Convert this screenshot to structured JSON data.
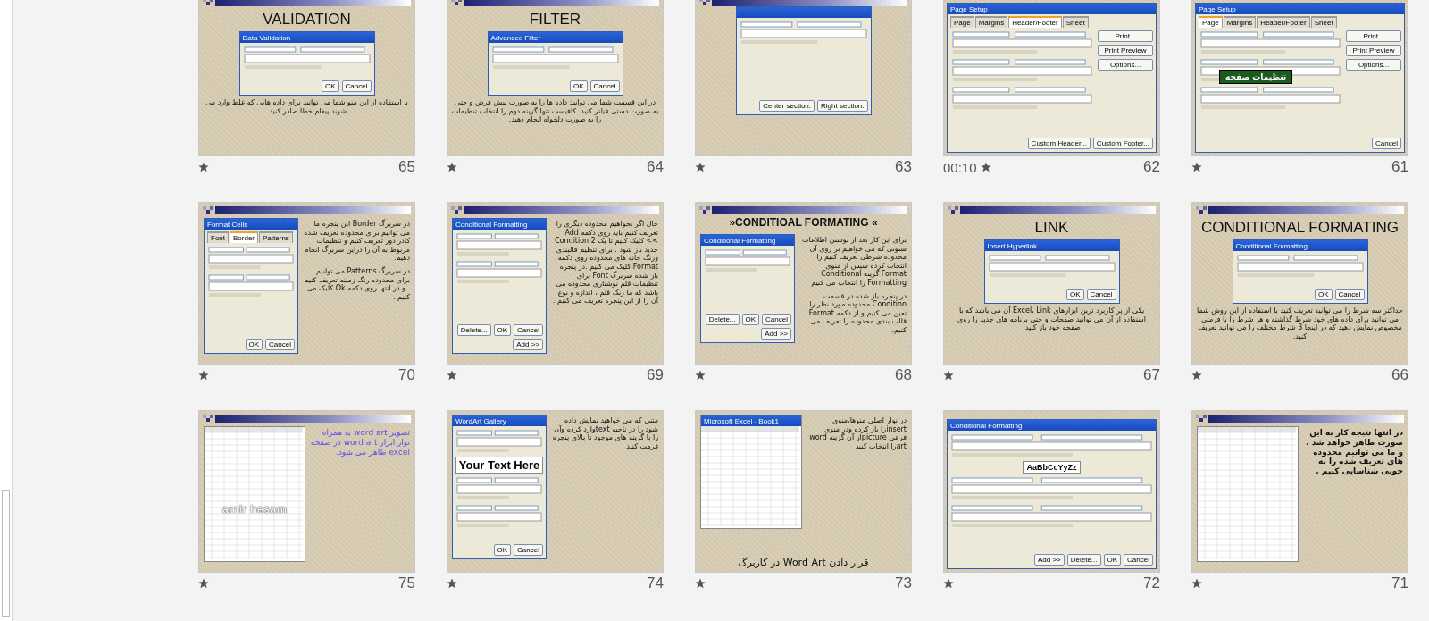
{
  "slides": [
    {
      "number": "61",
      "transition": true,
      "header_bar": false,
      "kind": "full",
      "callout": "تنظیمات صفحه",
      "shot": {
        "kind": "dialog",
        "title": "Page Setup",
        "tabs": [
          {
            "label": "Sheet",
            "selected": false
          },
          {
            "label": "Header/Footer",
            "selected": false
          },
          {
            "label": "Margins",
            "selected": false
          },
          {
            "label": "Page",
            "selected": true
          }
        ],
        "side_buttons": [
          "Print...",
          "Print Preview",
          "Options..."
        ],
        "buttons": [
          "Cancel"
        ]
      }
    },
    {
      "number": "62",
      "timing": "00:10",
      "transition": true,
      "header_bar": false,
      "kind": "full",
      "shot": {
        "kind": "dialog",
        "title": "Page Setup",
        "tabs": [
          {
            "label": "Sheet",
            "selected": false
          },
          {
            "label": "Header/Footer",
            "selected": true
          },
          {
            "label": "Margins",
            "selected": false
          },
          {
            "label": "Page",
            "selected": false
          }
        ],
        "side_buttons": [
          "Print...",
          "Print Preview",
          "Options..."
        ],
        "buttons": [
          "Custom Footer...",
          "Custom Header..."
        ]
      }
    },
    {
      "number": "63",
      "transition": true,
      "header_bar": true,
      "kind": "title-top",
      "shot": {
        "kind": "dialog",
        "buttons": [
          "Right section:",
          "Center section:"
        ]
      }
    },
    {
      "number": "64",
      "transition": true,
      "header_bar": true,
      "kind": "title-top",
      "title": "FILTER",
      "shot": {
        "kind": "dialog",
        "title": "Advanced Filter",
        "buttons": [
          "Cancel",
          "OK"
        ]
      },
      "body": [
        "در این قسمت شما می توانید داده ها را به صورت پیش فرض و حتی به صورت دستی فیلتر کنید. کافیست تنها گزینه دوم را انتخاب تنظیمات را به صورت دلخواه انجام دهید."
      ]
    },
    {
      "number": "65",
      "transition": true,
      "header_bar": true,
      "kind": "title-top",
      "title": "VALIDATION",
      "shot": {
        "kind": "dialog",
        "title": "Data Validation",
        "buttons": [
          "Cancel",
          "OK"
        ]
      },
      "body": [
        "با استفاده از این منو شما می توانید برای داده هایی که غلط وارد می شوند پیغام خطا صادر کنید."
      ]
    },
    {
      "number": "66",
      "transition": true,
      "header_bar": true,
      "kind": "title-top",
      "title": "CONDITIONAL FORMATING",
      "shot": {
        "kind": "dialog",
        "title": "Conditional Formatting",
        "buttons": [
          "Cancel",
          "OK"
        ]
      },
      "body": [
        "حداکثر سه شرط را می توانید تعریف کنید با استفاده از این روش شما می توانید برای داده های خود شرط گذاشته و هر شرط را با فرمتی مخصوص نمایش دهید که در اینجا 3 شرط مختلف را می توانید تعریف کنید."
      ]
    },
    {
      "number": "67",
      "transition": true,
      "header_bar": true,
      "kind": "title-top",
      "title": "LINK",
      "shot": {
        "kind": "dialog",
        "title": "Insert Hyperlink",
        "buttons": [
          "Cancel",
          "OK"
        ]
      },
      "body": [
        "یکی از پر کاربرد ترین ابزارهای Excel، Link آن می باشد که با استفاده از آن می توانید صفحات و حتی برنامه های جدید را روی صفحه خود باز کنید."
      ]
    },
    {
      "number": "68",
      "transition": true,
      "header_bar": true,
      "kind": "side",
      "title": "»CONDITIOAL FORMATING «",
      "shot": {
        "kind": "dialog",
        "title": "Conditional Formatting",
        "buttons": [
          "Cancel",
          "OK",
          "Delete...",
          "Add >>"
        ]
      },
      "body": [
        "برای این کار بعد از نوشتن اطلاعات ستونی که می خواهیم بر روی آن محدوده شرطی تعریف کنیم را انتخاب کرده سپس از منوی Format گزینه Conditional Formatting را انتخاب می کنیم",
        "در پنجره باز شده در قسمت Condition محدوده مورد نظر را تعین می کنیم و از دکمه Format قالب بندی محدوده را تعریف می کنیم."
      ]
    },
    {
      "number": "69",
      "transition": true,
      "header_bar": true,
      "kind": "side",
      "shot": {
        "kind": "dialog",
        "title": "Conditional Formatting",
        "buttons": [
          "Cancel",
          "OK",
          "Delete...",
          "Add >>"
        ]
      },
      "body": [
        "حال اگر بخواهیم محدوده دیگری را تعریف کنیم باید روی دکمه Add >> کلیک کنیم تا یک Condition 2 جدید باز شود . برای تنظیم قالبندی ورنگ خانه های محدوده روی دکمه Format کلیک می کنیم .در پنجره باز شده سربرگ Font برای تنظیمات قلم نوشتاری محدوده می باشد که ما رنگ قلم ، اندازه و نوع آن را از این پنجره تعریف می کنیم ."
      ]
    },
    {
      "number": "70",
      "transition": true,
      "header_bar": true,
      "kind": "side",
      "shot": {
        "kind": "dialog",
        "title": "Format Cells",
        "tabs": [
          {
            "label": "Patterns",
            "selected": false
          },
          {
            "label": "Border",
            "selected": true
          },
          {
            "label": "Font",
            "selected": false
          }
        ],
        "buttons": [
          "Cancel",
          "OK"
        ]
      },
      "body": [
        "در سربرگ Border این پنجره ما می توانیم برای محدوده تعریف شده کادر دور تعریف کنیم و تنظیمات مربوط به آن را دراین سربرگ انجام دهیم.",
        "در سربرگ Patterns می توانیم برای محدوده رنگ زمینه تعریف کنیم . و در انتها روی دکمه Ok کلیک می کنیم ."
      ]
    },
    {
      "number": "71",
      "transition": true,
      "header_bar": true,
      "kind": "side",
      "bold": true,
      "shot": {
        "kind": "sheet"
      },
      "body": [
        "در انتها نتیجه کار به این صورت ظاهر خواهد شد . و ما می توانیم محدوده های تعریف شده را به خوبی شناسایی کنیم ."
      ]
    },
    {
      "number": "72",
      "transition": true,
      "header_bar": false,
      "kind": "full",
      "shot": {
        "kind": "dialog",
        "title": "Conditional Formatting",
        "sample": "AaBbCcYyZz",
        "buttons": [
          "Cancel",
          "OK",
          "Delete...",
          "Add >>"
        ]
      }
    },
    {
      "number": "73",
      "transition": true,
      "header_bar": false,
      "kind": "side",
      "caption": "قرار دادن Word Art در کاربرگ",
      "shot": {
        "kind": "sheet",
        "title": "Microsoft Excel - Book1"
      },
      "body": [
        "در نوار اصلی منوها،منوی insertرا باز کرده ودر منوی فرعی pictureاز آن گزینه word artرا انتخاب کنید"
      ]
    },
    {
      "number": "74",
      "transition": true,
      "header_bar": false,
      "kind": "side",
      "shot": {
        "kind": "dialog",
        "title": "WordArt Gallery",
        "sample": "Your Text Here",
        "buttons": [
          "Cancel",
          "OK"
        ]
      },
      "body": [
        "متنی که می خواهید نمایش داده شود را در ناحیه textوارد کرده وآن را با گزینه های موجود تا بالای پنجره فرمت کنید"
      ]
    },
    {
      "number": "75",
      "transition": true,
      "header_bar": true,
      "kind": "side",
      "color": "#5a4ef0",
      "shot": {
        "kind": "sheet",
        "sample": "amir hesam"
      },
      "body": [
        "تصویر word art به همراه نوار ابزار word art در صفحه excel ظاهر می شود."
      ]
    }
  ]
}
